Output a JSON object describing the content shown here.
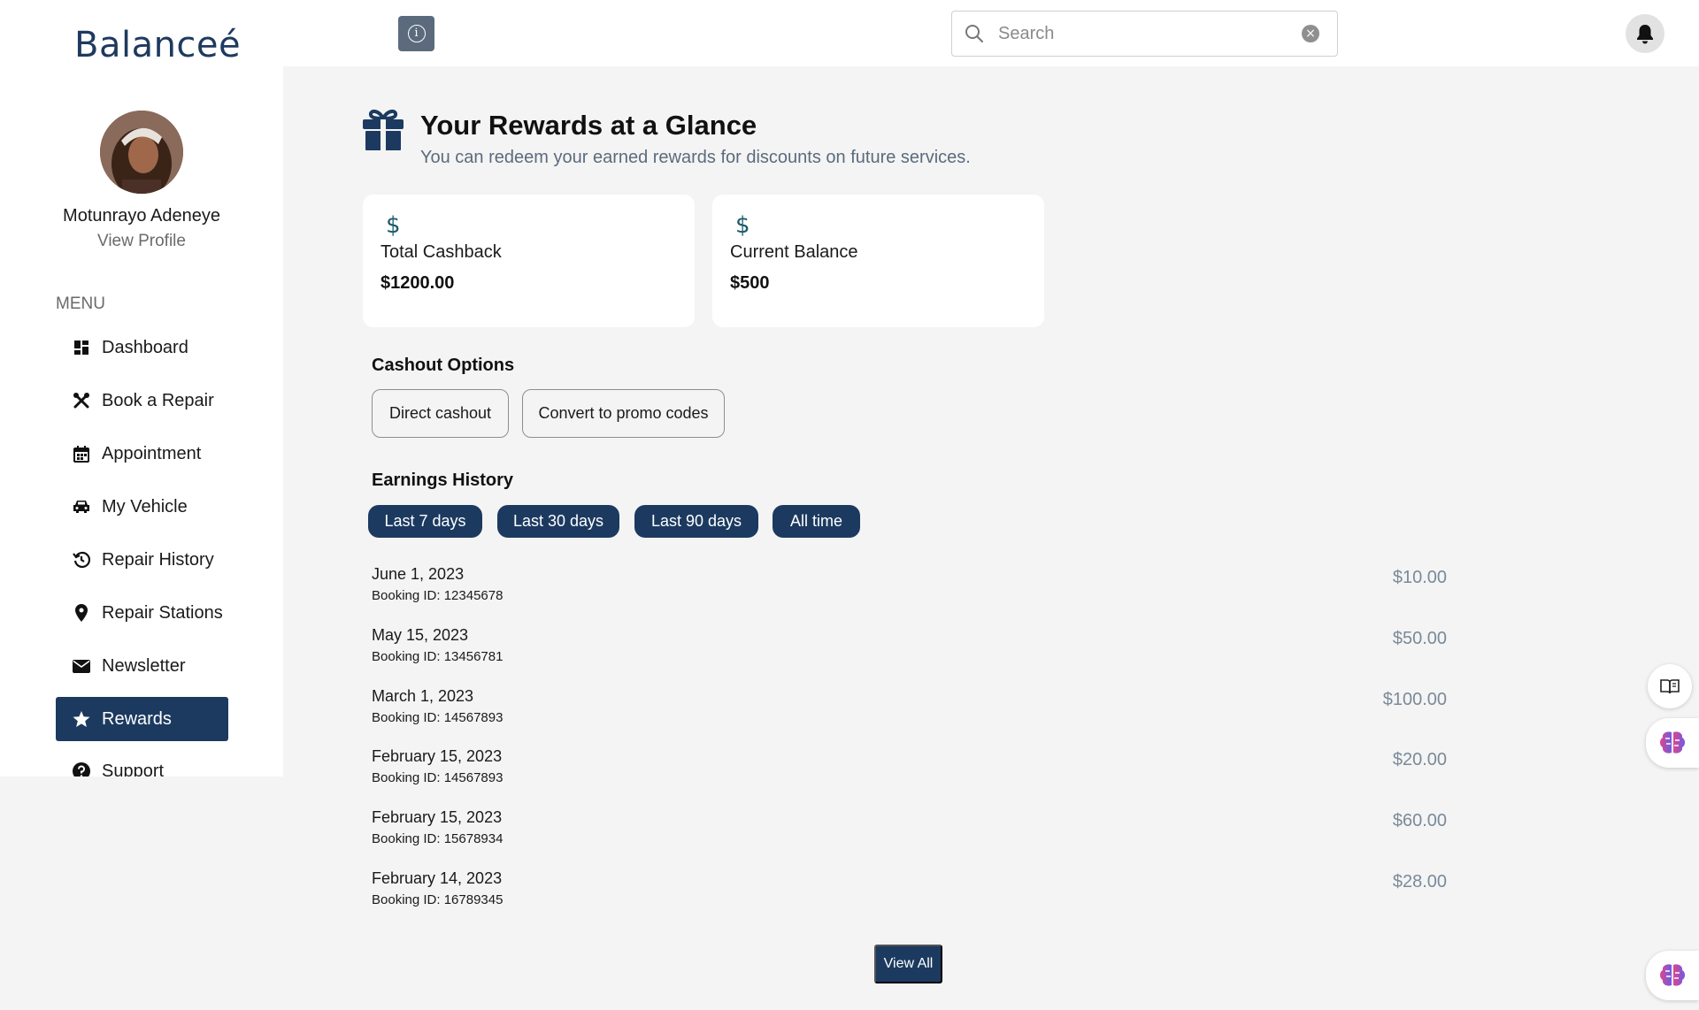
{
  "app": {
    "brand": "Balanceé"
  },
  "header": {
    "search_placeholder": "Search",
    "info_glyph": "i"
  },
  "profile": {
    "name": "Motunrayo Adeneye",
    "link": "View Profile"
  },
  "menu": {
    "label": "MENU",
    "items": [
      {
        "label": "Dashboard",
        "icon": "dashboard-icon"
      },
      {
        "label": "Book a Repair",
        "icon": "tools-icon"
      },
      {
        "label": "Appointment",
        "icon": "calendar-icon"
      },
      {
        "label": "My Vehicle",
        "icon": "car-icon"
      },
      {
        "label": "Repair History",
        "icon": "history-icon"
      },
      {
        "label": "Repair Stations",
        "icon": "location-pin-icon"
      },
      {
        "label": "Newsletter",
        "icon": "envelope-icon"
      },
      {
        "label": "Rewards",
        "icon": "star-icon",
        "active": true
      },
      {
        "label": "Support",
        "icon": "help-circle-icon"
      }
    ]
  },
  "main": {
    "title": "Your Rewards at a Glance",
    "subtitle": "You can redeem your earned rewards for discounts on future services.",
    "cards": [
      {
        "symbol": "$",
        "label": "Total Cashback",
        "value": "$1200.00"
      },
      {
        "symbol": "$",
        "label": "Current Balance",
        "value": "$500"
      }
    ],
    "cashout": {
      "title": "Cashout Options",
      "options": [
        "Direct cashout",
        "Convert to promo codes"
      ]
    },
    "history": {
      "title": "Earnings History",
      "filters": [
        "Last 7 days",
        "Last 30 days",
        "Last 90 days",
        "All time"
      ],
      "rows": [
        {
          "date": "June 1, 2023",
          "booking": "Booking ID: 12345678",
          "amount": "$10.00"
        },
        {
          "date": "May 15, 2023",
          "booking": "Booking ID: 13456781",
          "amount": "$50.00"
        },
        {
          "date": "March 1, 2023",
          "booking": "Booking ID: 14567893",
          "amount": "$100.00"
        },
        {
          "date": "February 15, 2023",
          "booking": "Booking ID: 14567893",
          "amount": "$20.00"
        },
        {
          "date": "February 15, 2023",
          "booking": "Booking ID: 15678934",
          "amount": "$60.00"
        },
        {
          "date": "February 14, 2023",
          "booking": "Booking ID: 16789345",
          "amount": "$28.00"
        }
      ],
      "view_all": "View All"
    }
  },
  "colors": {
    "primary": "#1c3a60",
    "brand_text": "#1e3a5f",
    "muted": "#5b6b7d",
    "amount": "#7a8a98",
    "background": "#f4f4f4"
  }
}
